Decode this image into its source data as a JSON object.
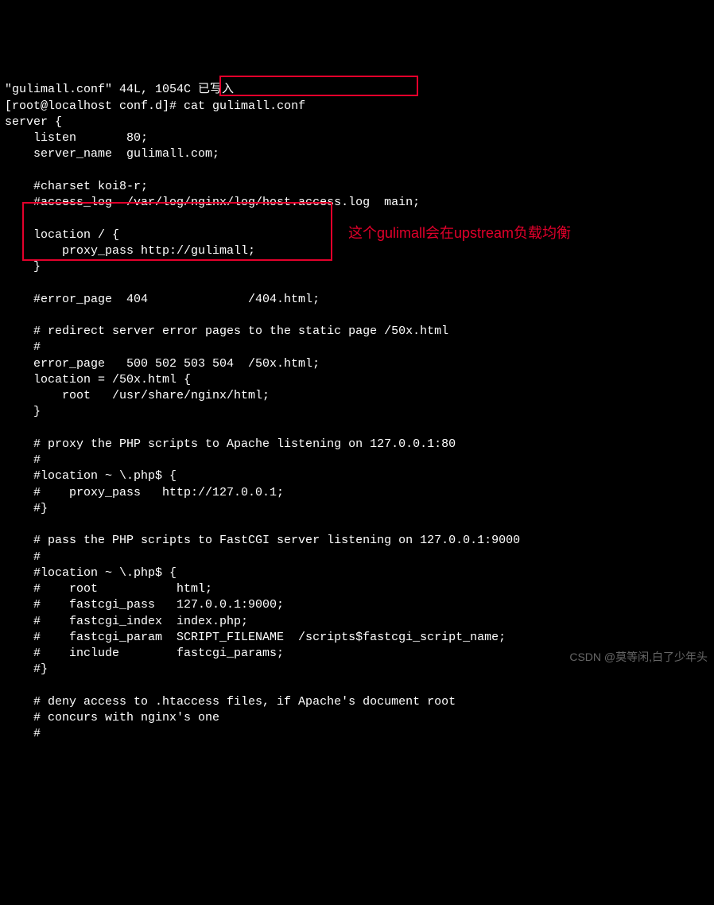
{
  "terminal": {
    "status_line": "\"gulimall.conf\" 44L, 1054C 已写入",
    "prompt": "[root@localhost conf.d]# ",
    "command": "cat gulimall.conf",
    "config": {
      "server_open": "server {",
      "listen": "    listen       80;",
      "server_name": "    server_name  gulimall.com;",
      "blank": "",
      "charset": "    #charset koi8-r;",
      "access_log": "    #access_log  /var/log/nginx/log/host.access.log  main;",
      "location_open": "    location / {",
      "proxy_pass": "        proxy_pass http://gulimall;",
      "location_close": "    }",
      "error_page_c": "    #error_page  404              /404.html;",
      "redirect_c": "    # redirect server error pages to the static page /50x.html",
      "hash": "    #",
      "error_page": "    error_page   500 502 503 504  /50x.html;",
      "loc50_open": "    location = /50x.html {",
      "loc50_root": "        root   /usr/share/nginx/html;",
      "loc50_close": "    }",
      "proxy_php_c": "    # proxy the PHP scripts to Apache listening on 127.0.0.1:80",
      "loc_php_open": "    #location ~ \\.php$ {",
      "loc_php_pass": "    #    proxy_pass   http://127.0.0.1;",
      "loc_php_close": "    #}",
      "fcgi_c": "    # pass the PHP scripts to FastCGI server listening on 127.0.0.1:9000",
      "fcgi_open": "    #location ~ \\.php$ {",
      "fcgi_root": "    #    root           html;",
      "fcgi_pass": "    #    fastcgi_pass   127.0.0.1:9000;",
      "fcgi_index": "    #    fastcgi_index  index.php;",
      "fcgi_param": "    #    fastcgi_param  SCRIPT_FILENAME  /scripts$fastcgi_script_name;",
      "fcgi_include": "    #    include        fastcgi_params;",
      "fcgi_close": "    #}",
      "deny_c1": "    # deny access to .htaccess files, if Apache's document root",
      "deny_c2": "    # concurs with nginx's one"
    }
  },
  "annotation": "这个gulimall会在upstream负载均衡",
  "watermark": "CSDN @莫等闲,白了少年头"
}
